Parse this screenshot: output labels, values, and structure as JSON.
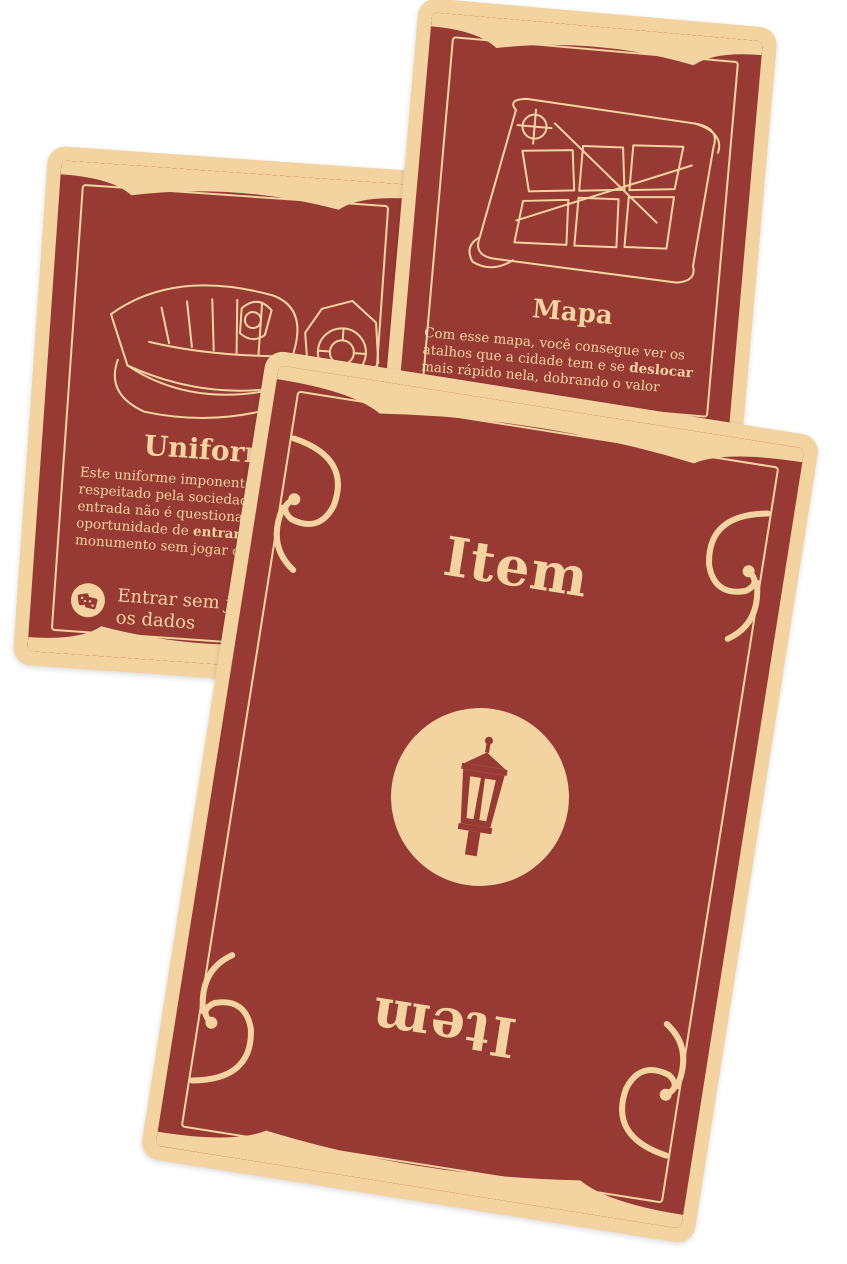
{
  "colors": {
    "card_red": "#973a33",
    "card_cream": "#f3d3a0",
    "background": "#ffffff"
  },
  "cards": {
    "uniforme": {
      "title": "Uniforme",
      "desc_part1": "Este uniforme imponente e chic é respeitado pela sociedade. Ao vestir, sua entrada não é questionada, tendo a oportunidade de ",
      "desc_bold": "entrar",
      "desc_part2": " em um monumento sem jogar os dados.",
      "ability_icon": "dice-icon",
      "ability_text": "Entrar sem jogar os dados",
      "illustration": "police-cap-and-badge-icon"
    },
    "mapa": {
      "title": "Mapa",
      "desc_part1": "Com esse mapa, você consegue ver os atalhos que a cidade tem e se ",
      "desc_bold": "deslocar",
      "desc_part2": " mais rápido nela, dobrando o valor tirado nos",
      "illustration": "city-map-scroll-icon"
    },
    "item": {
      "label_top": "Item",
      "label_bottom": "Item",
      "emblem_icon": "street-lamp-icon"
    }
  }
}
